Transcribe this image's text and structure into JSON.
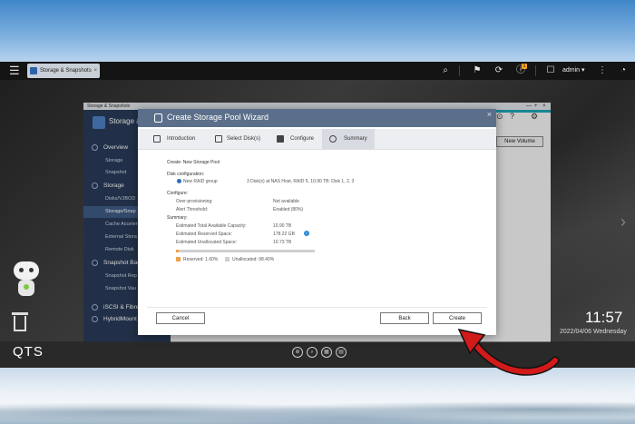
{
  "taskbar": {
    "tab_label": "Storage & Snapshots",
    "tab_close": "×",
    "user": "admin ▾",
    "notification_badge": "1"
  },
  "app": {
    "window_title": "Storage & Snapshots",
    "name": "Storage &",
    "sidebar": [
      {
        "label": "Overview",
        "type": "head"
      },
      {
        "label": "Storage",
        "type": "item"
      },
      {
        "label": "Snapshot",
        "type": "item"
      },
      {
        "label": "Storage",
        "type": "head"
      },
      {
        "label": "Disks/VJBOD",
        "type": "item"
      },
      {
        "label": "Storage/Snap",
        "type": "active"
      },
      {
        "label": "Cache Acceler",
        "type": "item"
      },
      {
        "label": "External Stora",
        "type": "item"
      },
      {
        "label": "Remote Disk",
        "type": "item"
      },
      {
        "label": "Snapshot Bac",
        "type": "head"
      },
      {
        "label": "Snapshot Rep",
        "type": "item"
      },
      {
        "label": "Snapshot Vau",
        "type": "item"
      },
      {
        "label": "iSCSI & Fibre",
        "type": "head"
      },
      {
        "label": "HybridMount",
        "type": "head"
      }
    ],
    "new_volume": "New Volume"
  },
  "wizard": {
    "title": "Create Storage Pool Wizard",
    "steps": [
      "Introduction",
      "Select Disk(s)",
      "Configure",
      "Summary"
    ],
    "create_label": "Create: New Storage Pool",
    "disk_config_label": "Disk configuration:",
    "raid_group": "New RAID group",
    "raid_detail": "3 Disk(s) at NAS Host, RAID 5, 10.90 TB: Disk 1, 2, 3",
    "configure_label": "Configure:",
    "over_provisioning_label": "Over-provisioning:",
    "over_provisioning_value": "Not available",
    "alert_threshold_label": "Alert Threshold:",
    "alert_threshold_value": "Enabled (80%)",
    "summary_label": "Summary:",
    "total_capacity_label": "Estimated Total Available Capacity:",
    "total_capacity_value": "10.90 TB",
    "reserved_label": "Estimated Reserved Space:",
    "reserved_value": "178.22 GB",
    "unallocated_label": "Estimated Unallocated Space:",
    "unallocated_value": "10.73 TB",
    "reserved_fraction": 0.016,
    "legend_reserved": "Reserved: 1.60%",
    "legend_unallocated": "Unallocated: 98.40%",
    "cancel": "Cancel",
    "back": "Back",
    "create": "Create"
  },
  "desktop": {
    "brand": "QTS",
    "time": "11:57",
    "date": "2022/04/06 Wednesday"
  },
  "colors": {
    "reserved": "#f0a04b",
    "unallocated": "#cfcfcf",
    "wizard_header": "#5b6f8a",
    "sidebar": "#293b58",
    "arrow": "#d11a1a"
  }
}
